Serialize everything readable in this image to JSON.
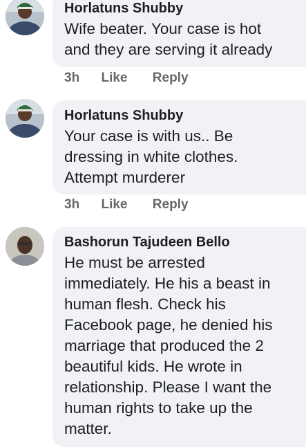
{
  "comments": [
    {
      "author": "Horlatuns Shubby",
      "text": "Wife beater. Your case is hot\nand they are serving it already",
      "time": "3h",
      "like_label": "Like",
      "reply_label": "Reply"
    },
    {
      "author": "Horlatuns Shubby",
      "text": "Your case is with us.. Be\ndressing in white clothes.\nAttempt murderer",
      "time": "3h",
      "like_label": "Like",
      "reply_label": "Reply"
    },
    {
      "author": "Bashorun Tajudeen Bello",
      "text": " He must be arrested\nimmediately. He his a beast in\nhuman flesh. Check his\nFacebook page, he denied his\nmarriage that produced the 2\nbeautiful kids. He wrote in\nrelationship. Please I want the\nhuman rights to take up the\nmatter."
    }
  ]
}
